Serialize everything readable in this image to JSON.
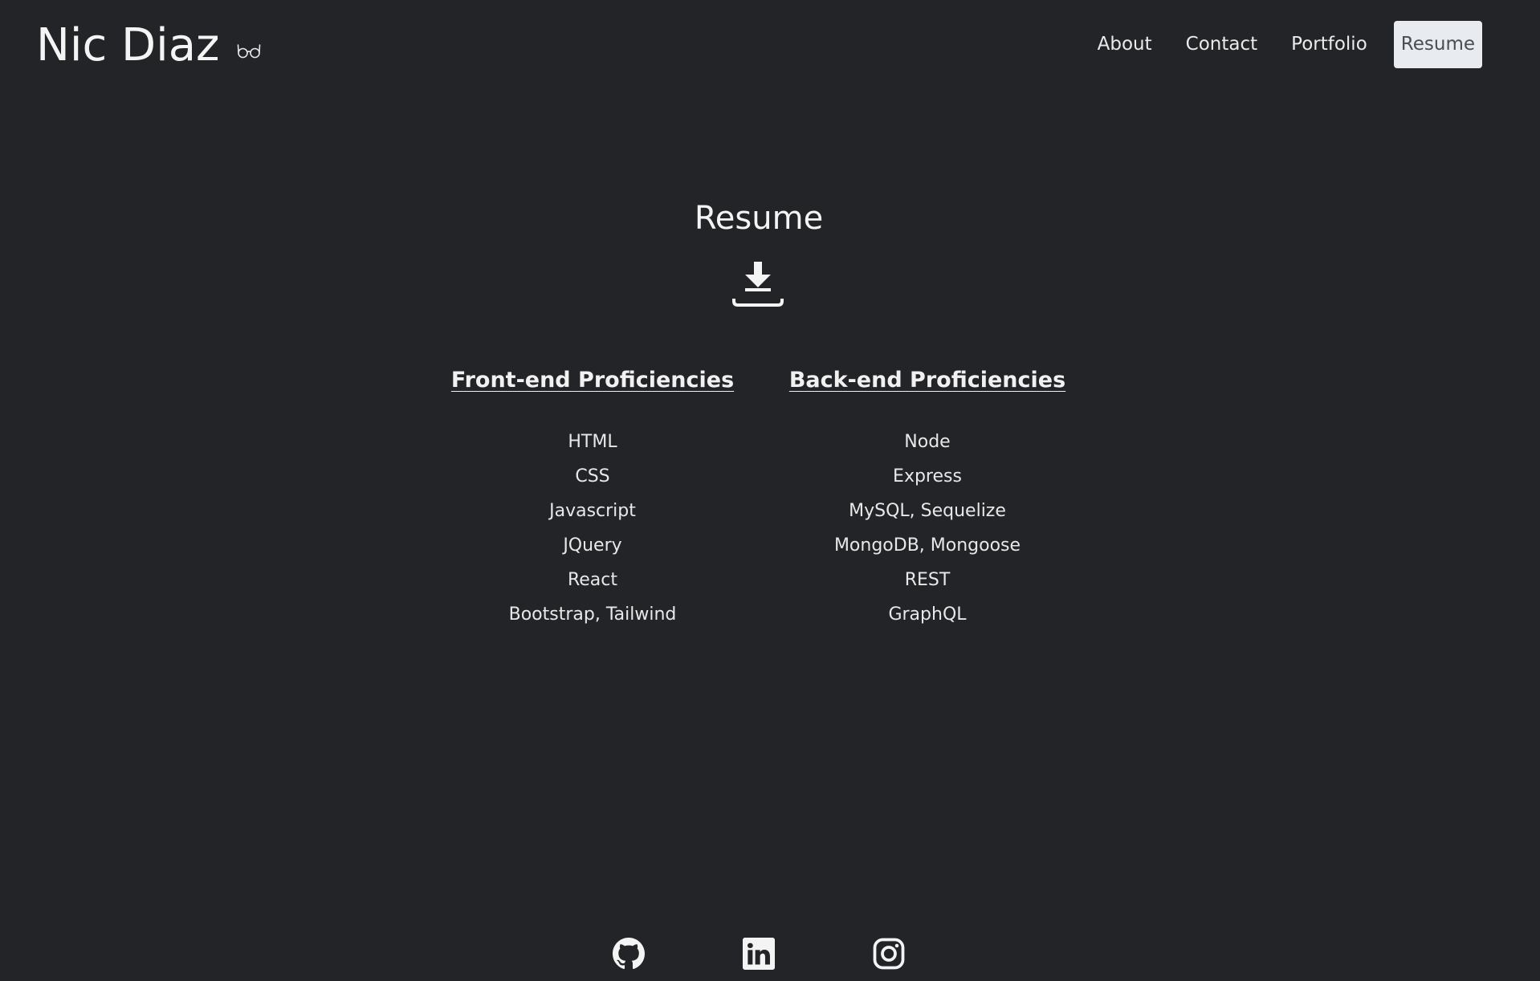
{
  "header": {
    "brand": "Nic Diaz",
    "brand_icon": "glasses-icon",
    "nav": [
      {
        "label": "About",
        "active": false
      },
      {
        "label": "Contact",
        "active": false
      },
      {
        "label": "Portfolio",
        "active": false
      },
      {
        "label": "Resume",
        "active": true
      }
    ]
  },
  "main": {
    "title": "Resume",
    "download_icon": "download-icon",
    "front_end": {
      "title": "Front-end Proficiencies",
      "items": [
        "HTML",
        "CSS",
        "Javascript",
        "JQuery",
        "React",
        "Bootstrap, Tailwind"
      ]
    },
    "back_end": {
      "title": "Back-end Proficiencies",
      "items": [
        "Node",
        "Express",
        "MySQL, Sequelize",
        "MongoDB, Mongoose",
        "REST",
        "GraphQL"
      ]
    }
  },
  "footer": {
    "icons": [
      "github-icon",
      "linkedin-icon",
      "instagram-icon"
    ]
  },
  "colors": {
    "background": "#232427",
    "text": "#f2f2f2",
    "active_nav_bg": "#e8ebf0",
    "active_nav_text": "#4a4d52"
  }
}
